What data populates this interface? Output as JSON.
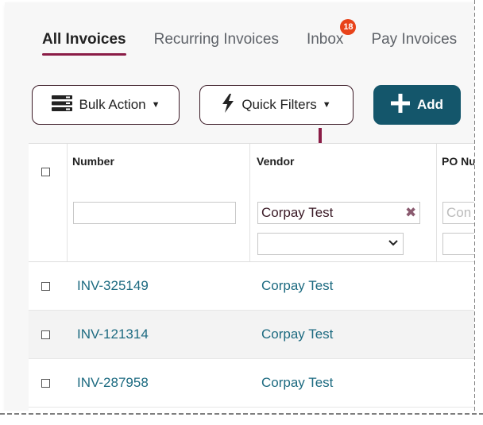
{
  "tabs": [
    {
      "label": "All Invoices",
      "active": true
    },
    {
      "label": "Recurring Invoices",
      "active": false
    },
    {
      "label": "Inbox",
      "active": false,
      "badge": "18"
    },
    {
      "label": "Pay Invoices",
      "active": false
    }
  ],
  "toolbar": {
    "bulk_action": "Bulk Action",
    "quick_filters": "Quick Filters",
    "add": "Add"
  },
  "table": {
    "columns": [
      "Number",
      "Vendor",
      "PO Nu"
    ],
    "filters": {
      "number_value": "",
      "vendor_value": "Corpay Test",
      "po_placeholder": "Con"
    },
    "rows": [
      {
        "number": "INV-325149",
        "vendor": "Corpay Test"
      },
      {
        "number": "INV-121314",
        "vendor": "Corpay Test"
      },
      {
        "number": "INV-287958",
        "vendor": "Corpay Test"
      }
    ]
  },
  "colors": {
    "accent": "#8a1c46",
    "primary_button": "#14566b",
    "link": "#1c6a80",
    "badge": "#e8431a"
  },
  "icons": [
    "server-stack-icon",
    "lightning-icon",
    "plus-icon",
    "caret-down-icon",
    "clear-icon",
    "chevron-down-icon",
    "arrow-down-icon"
  ]
}
